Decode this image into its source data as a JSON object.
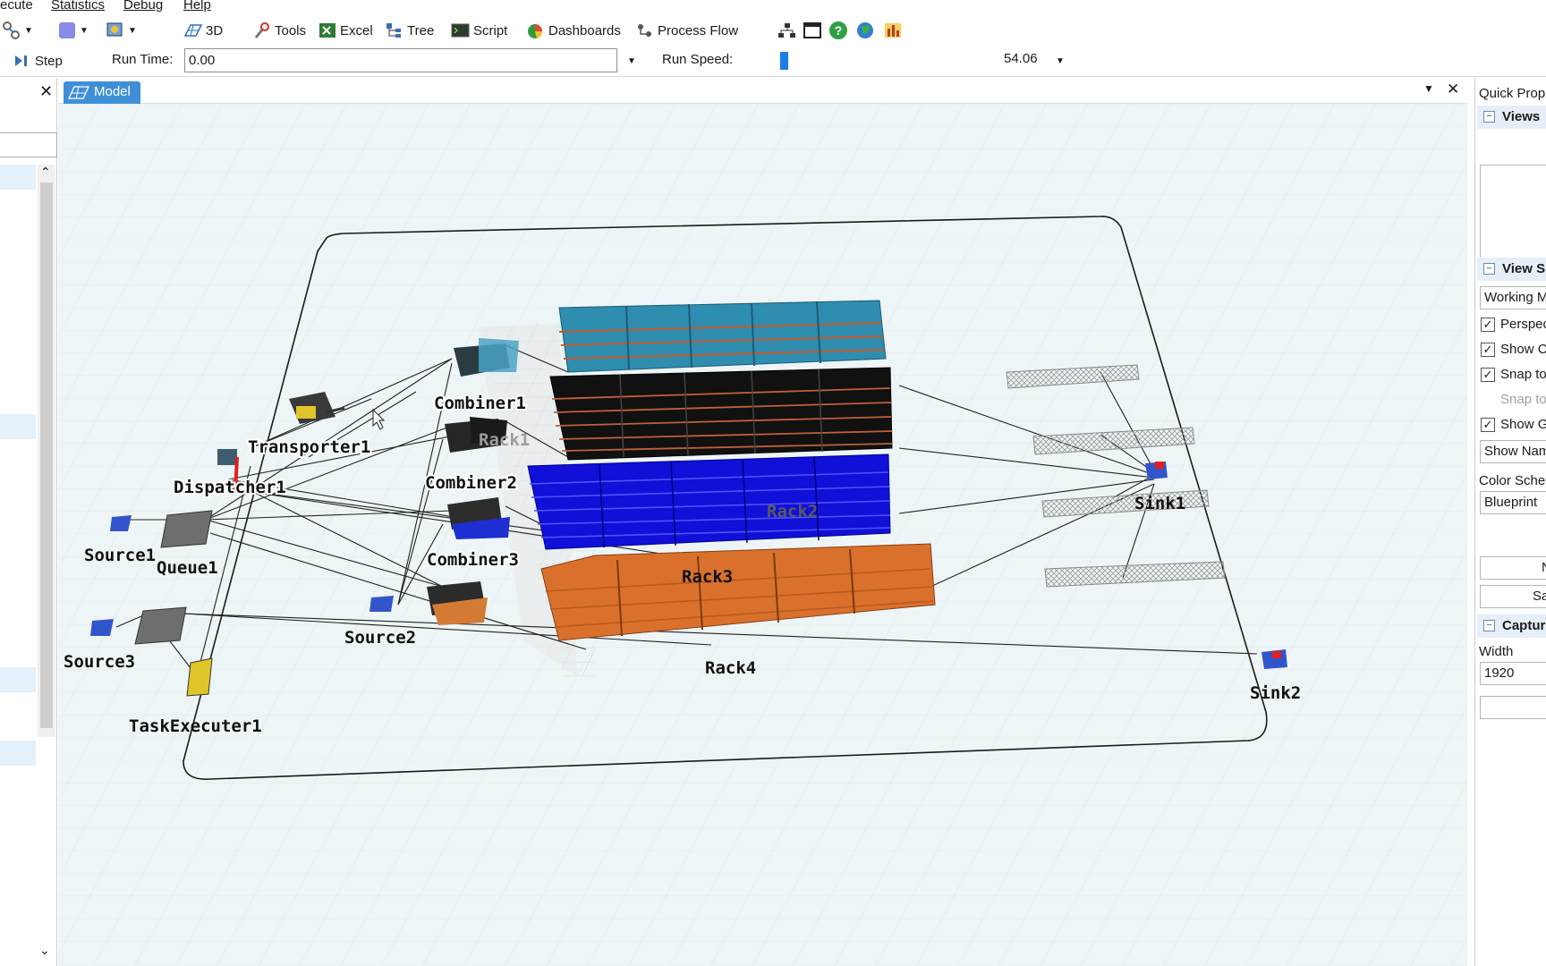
{
  "menu": {
    "items": [
      "ecute",
      "Statistics",
      "Debug",
      "Help"
    ]
  },
  "toolbar": {
    "btn_3d": "3D",
    "btn_tools": "Tools",
    "btn_excel": "Excel",
    "btn_tree": "Tree",
    "btn_script": "Script",
    "btn_dashboards": "Dashboards",
    "btn_process_flow": "Process Flow"
  },
  "run": {
    "step_label": "Step",
    "run_time_label": "Run Time:",
    "run_time_value": "0.00",
    "run_speed_label": "Run Speed:",
    "run_speed_value": "54.06"
  },
  "tabs": {
    "model": "Model"
  },
  "model_objects": {
    "combiner1": "Combiner1",
    "combiner2": "Combiner2",
    "combiner3": "Combiner3",
    "transporter1": "Transporter1",
    "dispatcher1": "Dispatcher1",
    "source1": "Source1",
    "source2": "Source2",
    "source3": "Source3",
    "queue1": "Queue1",
    "task_executer1": "TaskExecuter1",
    "rack1": "Rack1",
    "rack2": "Rack2",
    "rack3": "Rack3",
    "rack4": "Rack4",
    "sink1": "Sink1",
    "sink2": "Sink2"
  },
  "quick_properties": {
    "title": "Quick Prop",
    "views_header": "Views",
    "view_settings_header": "View S",
    "view_mode": "Working M",
    "perspective": "Perspec",
    "show_c": "Show C",
    "snap_to_1": "Snap to",
    "snap_to_2": "Snap to",
    "show_g": "Show G",
    "show_names": "Show Nam",
    "color_scheme_label": "Color Sche",
    "color_scheme_value": "Blueprint",
    "btn_n": "N",
    "btn_sa": "Sa",
    "capture_header": "Captur",
    "width_label": "Width",
    "width_value": "1920"
  },
  "colors": {
    "rack1": "#2f8db0",
    "rack2": "#111111",
    "rack3": "#1010d8",
    "rack4": "#d9712c",
    "tab_active": "#3f8fd8",
    "canvas_bg": "#eef5f7"
  }
}
